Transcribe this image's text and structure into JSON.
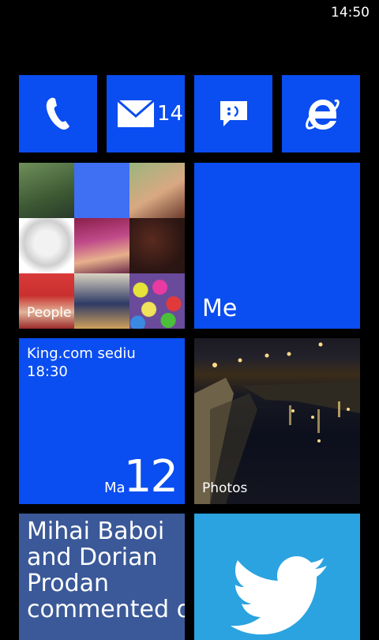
{
  "status_bar": {
    "time": "14:50"
  },
  "tiles": {
    "phone": {
      "icon": "phone-icon",
      "color": "#0a4df0"
    },
    "mail": {
      "icon": "mail-icon",
      "count": "14",
      "color": "#0a4df0"
    },
    "messaging": {
      "icon": "messaging-icon",
      "color": "#0a4df0"
    },
    "browser": {
      "icon": "internet-explorer-icon",
      "color": "#0a4df0"
    },
    "people": {
      "label": "People"
    },
    "me": {
      "label": "Me"
    },
    "calendar": {
      "event_title": "King.com sediu",
      "event_time": "18:30",
      "day": "Ma",
      "date": "12"
    },
    "photos": {
      "label": "Photos"
    },
    "social": {
      "text": "Mihai Baboi and Dorian Prodan commented o",
      "color": "#3b5998"
    },
    "twitter": {
      "icon": "twitter-bird-icon",
      "color": "#2aa3e0"
    }
  },
  "colors": {
    "accent": "#0a4df0",
    "background": "#000000"
  }
}
